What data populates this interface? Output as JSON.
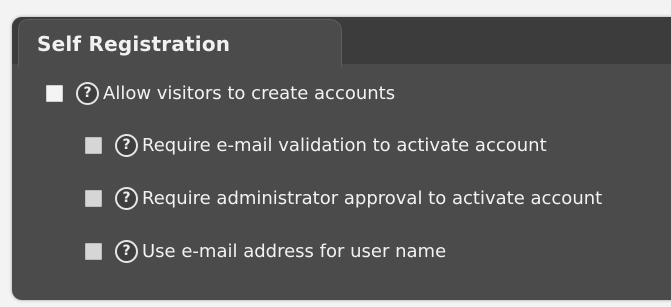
{
  "panel": {
    "title": "Self Registration"
  },
  "options": [
    {
      "label": "Allow visitors to create accounts",
      "help": "?",
      "checked": false
    },
    {
      "label": "Require e-mail validation to activate account",
      "help": "?",
      "checked": false
    },
    {
      "label": "Require administrator approval to activate account",
      "help": "?",
      "checked": false
    },
    {
      "label": "Use e-mail address for user name",
      "help": "?",
      "checked": false
    }
  ],
  "icons": {
    "help": "help-question-icon"
  },
  "colors": {
    "panel_bg": "#4b4b4b",
    "header_bg": "#3c3c3c",
    "text": "#f2f2f2"
  }
}
